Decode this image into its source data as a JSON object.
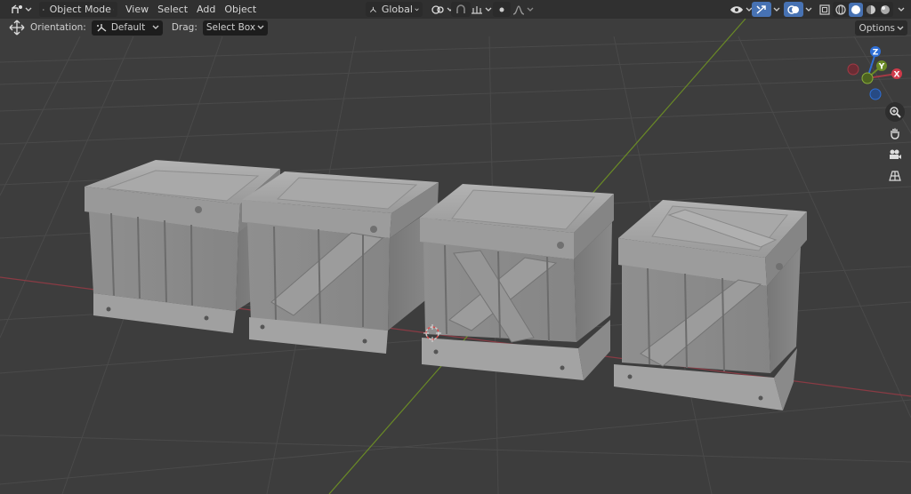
{
  "header": {
    "mode": "Object Mode",
    "menus": [
      "View",
      "Select",
      "Add",
      "Object"
    ],
    "transform_orientation": "Global"
  },
  "toolbar": {
    "orientation_label": "Orientation:",
    "orientation_value": "Default",
    "drag_label": "Drag:",
    "drag_value": "Select Box",
    "options_label": "Options"
  },
  "gizmo": {
    "z_label": "Z",
    "y_label": "Y",
    "x_label": "X"
  },
  "colors": {
    "x_axis": "#a33a45",
    "y_axis": "#6a8a26",
    "z_axis": "#2f6fd6",
    "active_button": "#4772b3",
    "header_bg": "#303030",
    "viewport_bg": "#3d3d3d"
  },
  "icons": [
    "editor-type-icon",
    "object-mode-icon",
    "transform-orientation-icon",
    "pivot-icon",
    "snap-icon",
    "snap-increment-icon",
    "proportional-edit-icon",
    "falloff-icon",
    "visibility-icon",
    "gizmo-icon",
    "overlays-icon",
    "xray-icon",
    "shading-wireframe-icon",
    "shading-solid-icon",
    "shading-material-icon",
    "shading-rendered-icon",
    "move-tool-icon",
    "zoom-icon",
    "hand-pan-icon",
    "camera-icon",
    "grid-perspective-icon",
    "3d-cursor-icon"
  ],
  "scene": {
    "objects": [
      "crate-1",
      "crate-2",
      "crate-3",
      "crate-4"
    ]
  }
}
